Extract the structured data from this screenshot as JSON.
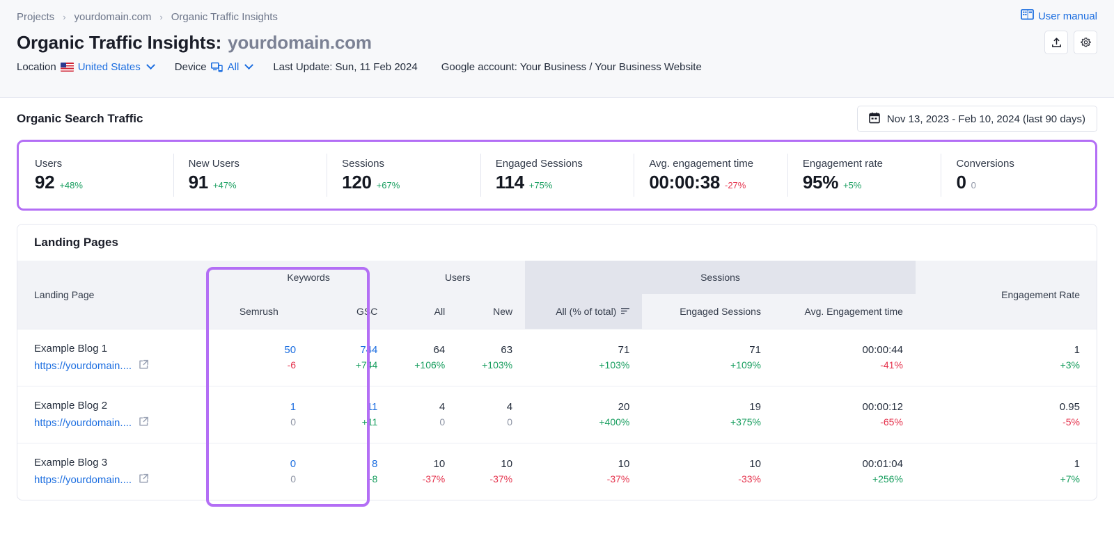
{
  "breadcrumb": {
    "items": [
      "Projects",
      "yourdomain.com",
      "Organic Traffic Insights"
    ],
    "separator": "›"
  },
  "header": {
    "title_main": "Organic Traffic Insights:",
    "title_domain": "yourdomain.com",
    "user_manual": "User manual",
    "export_icon": "upload-icon",
    "settings_icon": "gear-icon",
    "filters": {
      "location_label": "Location",
      "location_value": "United States",
      "device_label": "Device",
      "device_value": "All",
      "last_update": "Last Update: Sun, 11 Feb 2024",
      "google_account": "Google account: Your Business / Your Business Website"
    }
  },
  "section": {
    "title": "Organic Search Traffic",
    "date_range": "Nov 13, 2023 - Feb 10, 2024 (last 90 days)",
    "calendar_icon": "calendar-icon"
  },
  "metrics": [
    {
      "label": "Users",
      "value": "92",
      "delta": "+48%",
      "dir": "up"
    },
    {
      "label": "New Users",
      "value": "91",
      "delta": "+47%",
      "dir": "up"
    },
    {
      "label": "Sessions",
      "value": "120",
      "delta": "+67%",
      "dir": "up"
    },
    {
      "label": "Engaged Sessions",
      "value": "114",
      "delta": "+75%",
      "dir": "up"
    },
    {
      "label": "Avg. engagement time",
      "value": "00:00:38",
      "delta": "-27%",
      "dir": "down"
    },
    {
      "label": "Engagement rate",
      "value": "95%",
      "delta": "+5%",
      "dir": "up"
    },
    {
      "label": "Conversions",
      "value": "0",
      "delta": "0",
      "dir": "neutral"
    }
  ],
  "table": {
    "card_title": "Landing Pages",
    "groups": {
      "landing_page": "Landing Page",
      "keywords": "Keywords",
      "users": "Users",
      "sessions": "Sessions",
      "engagement_rate": "Engagement Rate"
    },
    "subheaders": {
      "semrush": "Semrush",
      "gsc": "GSC",
      "users_all": "All",
      "users_new": "New",
      "sessions_all": "All (% of total)",
      "sessions_engaged": "Engaged Sessions",
      "sessions_time": "Avg. Engagement time",
      "sort_icon": "sort-descending-icon"
    },
    "rows": [
      {
        "name": "Example Blog 1",
        "url": "https://yourdomain....",
        "link_icon": "external-link-icon",
        "kw_semrush": "50",
        "kw_semrush_d": "-6",
        "kw_semrush_dir": "down",
        "kw_gsc": "744",
        "kw_gsc_d": "+744",
        "kw_gsc_dir": "up",
        "users_all": "64",
        "users_all_d": "+106%",
        "users_all_dir": "up",
        "users_new": "63",
        "users_new_d": "+103%",
        "users_new_dir": "up",
        "sess_all": "71",
        "sess_all_d": "+103%",
        "sess_all_dir": "up",
        "sess_eng": "71",
        "sess_eng_d": "+109%",
        "sess_eng_dir": "up",
        "sess_time": "00:00:44",
        "sess_time_d": "-41%",
        "sess_time_dir": "down",
        "eng_rate": "1",
        "eng_rate_d": "+3%",
        "eng_rate_dir": "up"
      },
      {
        "name": "Example Blog 2",
        "url": "https://yourdomain....",
        "link_icon": "external-link-icon",
        "kw_semrush": "1",
        "kw_semrush_d": "0",
        "kw_semrush_dir": "neutral",
        "kw_gsc": "11",
        "kw_gsc_d": "+11",
        "kw_gsc_dir": "up",
        "users_all": "4",
        "users_all_d": "0",
        "users_all_dir": "neutral",
        "users_new": "4",
        "users_new_d": "0",
        "users_new_dir": "neutral",
        "sess_all": "20",
        "sess_all_d": "+400%",
        "sess_all_dir": "up",
        "sess_eng": "19",
        "sess_eng_d": "+375%",
        "sess_eng_dir": "up",
        "sess_time": "00:00:12",
        "sess_time_d": "-65%",
        "sess_time_dir": "down",
        "eng_rate": "0.95",
        "eng_rate_d": "-5%",
        "eng_rate_dir": "down"
      },
      {
        "name": "Example Blog 3",
        "url": "https://yourdomain....",
        "link_icon": "external-link-icon",
        "kw_semrush": "0",
        "kw_semrush_d": "0",
        "kw_semrush_dir": "neutral",
        "kw_gsc": "8",
        "kw_gsc_d": "+8",
        "kw_gsc_dir": "up",
        "users_all": "10",
        "users_all_d": "-37%",
        "users_all_dir": "down",
        "users_new": "10",
        "users_new_d": "-37%",
        "users_new_dir": "down",
        "sess_all": "10",
        "sess_all_d": "-37%",
        "sess_all_dir": "down",
        "sess_eng": "10",
        "sess_eng_d": "-33%",
        "sess_eng_dir": "down",
        "sess_time": "00:01:04",
        "sess_time_d": "+256%",
        "sess_time_dir": "up",
        "eng_rate": "1",
        "eng_rate_d": "+7%",
        "eng_rate_dir": "up"
      }
    ]
  },
  "colors": {
    "highlight": "#b36ef5",
    "link": "#1c6ee0",
    "positive": "#189e5f",
    "negative": "#e5334d",
    "neutral": "#8d94a4"
  }
}
